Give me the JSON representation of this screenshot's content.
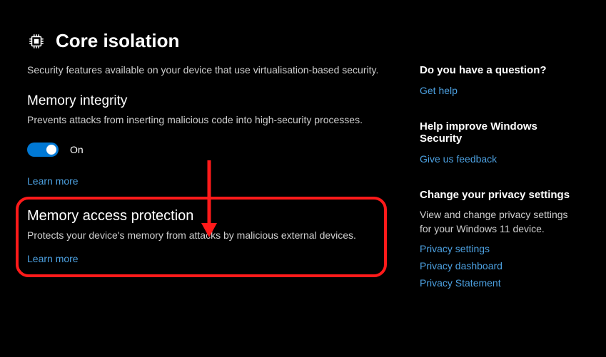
{
  "header": {
    "title": "Core isolation",
    "description": "Security features available on your device that use virtualisation-based security."
  },
  "memory_integrity": {
    "heading": "Memory integrity",
    "description": "Prevents attacks from inserting malicious code into high-security processes.",
    "toggle_state": "On",
    "learn_more": "Learn more"
  },
  "memory_access_protection": {
    "heading": "Memory access protection",
    "description": "Protects your device's memory from attacks by malicious external devices.",
    "learn_more": "Learn more"
  },
  "sidebar": {
    "question": {
      "heading": "Do you have a question?",
      "link": "Get help"
    },
    "feedback": {
      "heading": "Help improve Windows Security",
      "link": "Give us feedback"
    },
    "privacy": {
      "heading": "Change your privacy settings",
      "description": "View and change privacy settings for your Windows 11 device.",
      "links": [
        "Privacy settings",
        "Privacy dashboard",
        "Privacy Statement"
      ]
    }
  }
}
